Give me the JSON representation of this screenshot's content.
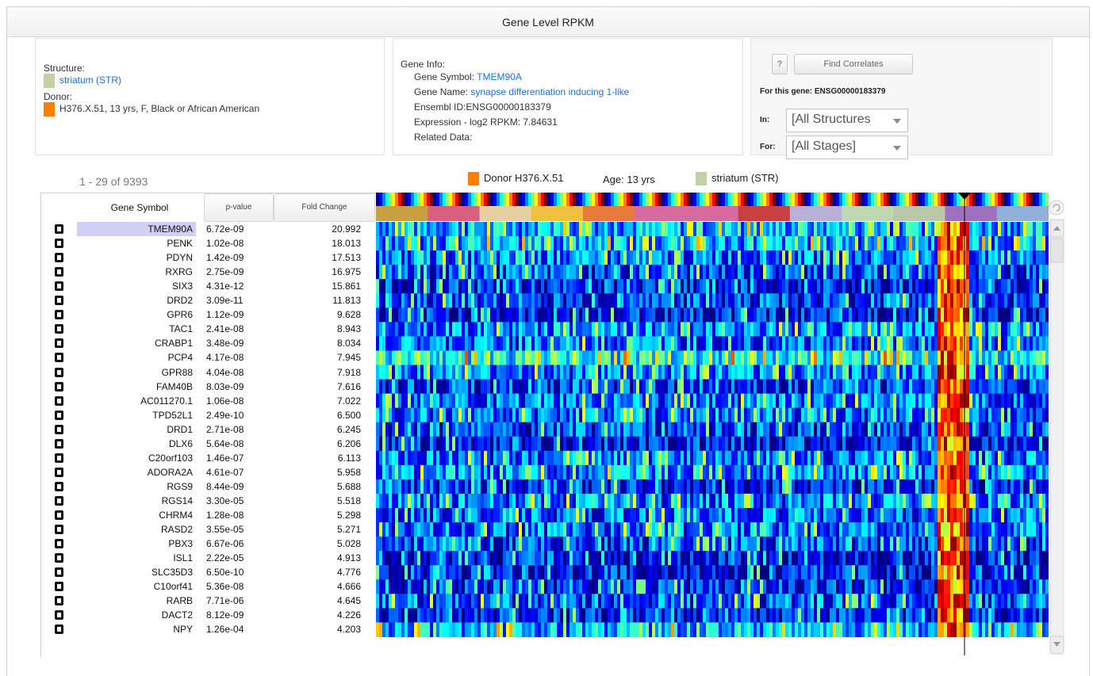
{
  "page": {
    "title": "Gene Level RPKM"
  },
  "structure_panel": {
    "structure_label": "Structure:",
    "structure_value": "striatum (STR)",
    "donor_label": "Donor:",
    "donor_value": "H376.X.51, 13 yrs, F, Black or African American"
  },
  "gene_info": {
    "heading": "Gene Info:",
    "symbol_label": "Gene Symbol: ",
    "symbol_value": "TMEM90A",
    "name_label": "Gene Name: ",
    "name_value": "synapse differentiation inducing 1-like",
    "ensembl": "Ensembl ID:ENSG00000183379",
    "expression": "Expression - log2 RPKM: 7.84631",
    "related": "Related Data:"
  },
  "correlates": {
    "help_label": "?",
    "find_label": "Find Correlates",
    "for_gene": "For this gene: ENSG00000183379",
    "in_label": "In:",
    "in_value": "[All Structures",
    "for_label": "For:",
    "for_value": "[All Stages]"
  },
  "legend": {
    "donor": "Donor H376.X.51",
    "age": "Age: 13 yrs",
    "structure": "striatum (STR)"
  },
  "count_text": "1 - 29 of 9393",
  "columns": {
    "symbol": "Gene Symbol",
    "pvalue": "p-value",
    "fold": "Fold Change"
  },
  "rows": [
    {
      "symbol": "TMEM90A",
      "p": "6.72e-09",
      "fold": "20.992",
      "level": 0.55
    },
    {
      "symbol": "PENK",
      "p": "1.02e-08",
      "fold": "18.013",
      "level": 0.52
    },
    {
      "symbol": "PDYN",
      "p": "1.42e-09",
      "fold": "17.513",
      "level": 0.4
    },
    {
      "symbol": "RXRG",
      "p": "2.75e-09",
      "fold": "16.975",
      "level": 0.32
    },
    {
      "symbol": "SIX3",
      "p": "4.31e-12",
      "fold": "15.861",
      "level": 0.22
    },
    {
      "symbol": "DRD2",
      "p": "3.09e-11",
      "fold": "11.813",
      "level": 0.3
    },
    {
      "symbol": "GPR6",
      "p": "1.12e-09",
      "fold": "9.628",
      "level": 0.2
    },
    {
      "symbol": "TAC1",
      "p": "2.41e-08",
      "fold": "8.943",
      "level": 0.45
    },
    {
      "symbol": "CRABP1",
      "p": "3.48e-09",
      "fold": "8.034",
      "level": 0.4
    },
    {
      "symbol": "PCP4",
      "p": "4.17e-08",
      "fold": "7.945",
      "level": 0.7
    },
    {
      "symbol": "GPR88",
      "p": "4.04e-08",
      "fold": "7.918",
      "level": 0.42
    },
    {
      "symbol": "FAM40B",
      "p": "8.03e-09",
      "fold": "7.616",
      "level": 0.3
    },
    {
      "symbol": "AC011270.1",
      "p": "1.06e-08",
      "fold": "7.022",
      "level": 0.38
    },
    {
      "symbol": "TPD52L1",
      "p": "2.49e-10",
      "fold": "6.500",
      "level": 0.38
    },
    {
      "symbol": "DRD1",
      "p": "2.71e-08",
      "fold": "6.245",
      "level": 0.3
    },
    {
      "symbol": "DLX6",
      "p": "5.64e-08",
      "fold": "6.206",
      "level": 0.22
    },
    {
      "symbol": "C20orf103",
      "p": "1.46e-07",
      "fold": "6.113",
      "level": 0.4
    },
    {
      "symbol": "ADORA2A",
      "p": "4.61e-07",
      "fold": "5.958",
      "level": 0.45
    },
    {
      "symbol": "RGS9",
      "p": "8.44e-09",
      "fold": "5.688",
      "level": 0.25
    },
    {
      "symbol": "RGS14",
      "p": "3.30e-05",
      "fold": "5.518",
      "level": 0.42
    },
    {
      "symbol": "CHRM4",
      "p": "1.28e-08",
      "fold": "5.298",
      "level": 0.38
    },
    {
      "symbol": "RASD2",
      "p": "3.55e-05",
      "fold": "5.271",
      "level": 0.4
    },
    {
      "symbol": "PBX3",
      "p": "6.67e-06",
      "fold": "5.028",
      "level": 0.32
    },
    {
      "symbol": "ISL1",
      "p": "2.22e-05",
      "fold": "4.913",
      "level": 0.15
    },
    {
      "symbol": "SLC35D3",
      "p": "6.50e-10",
      "fold": "4.776",
      "level": 0.2
    },
    {
      "symbol": "C10orf41",
      "p": "5.36e-08",
      "fold": "4.666",
      "level": 0.25
    },
    {
      "symbol": "RARB",
      "p": "7.71e-06",
      "fold": "4.645",
      "level": 0.35
    },
    {
      "symbol": "DACT2",
      "p": "8.12e-09",
      "fold": "4.226",
      "level": 0.22
    },
    {
      "symbol": "NPY",
      "p": "1.26e-04",
      "fold": "4.203",
      "level": 0.55
    }
  ],
  "colors": {
    "structure_swatch": "#c3d2a5",
    "donor_swatch": "#ff8000",
    "selected_row": "#d0d0f7",
    "link": "#1f6fe0"
  },
  "structure_band_colors": [
    "#c8a040",
    "#d95f7f",
    "#e6cfa0",
    "#f0c040",
    "#e87a3a",
    "#d86aa0",
    "#d86aa0",
    "#c84040",
    "#b8b0d8",
    "#c0d8b0",
    "#b8c8a8",
    "#a070c0",
    "#90b0d8"
  ],
  "icons": {
    "checkbox": "checkbox-icon",
    "refresh": "refresh-icon",
    "scroll_up": "scroll-up-icon",
    "scroll_down": "scroll-down-icon",
    "marker": "triangle-marker-icon"
  }
}
